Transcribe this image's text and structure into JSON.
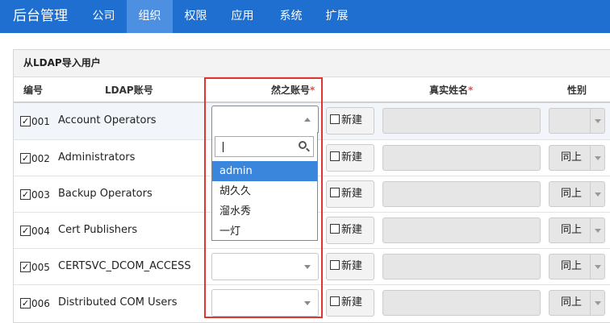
{
  "nav": {
    "brand": "后台管理",
    "items": [
      {
        "label": "公司",
        "active": false
      },
      {
        "label": "组织",
        "active": true
      },
      {
        "label": "权限",
        "active": false
      },
      {
        "label": "应用",
        "active": false
      },
      {
        "label": "系统",
        "active": false
      },
      {
        "label": "扩展",
        "active": false
      }
    ]
  },
  "panel": {
    "title": "从LDAP导入用户",
    "columns": {
      "number": "编号",
      "ldap_account": "LDAP账号",
      "ranzhi_account": "然之账号",
      "real_name": "真实姓名",
      "gender": "性别",
      "required_mark": "*"
    },
    "new_label": "新建",
    "rows": [
      {
        "number": "001",
        "checked": true,
        "ldap": "Account Operators",
        "account": "",
        "gender": ""
      },
      {
        "number": "002",
        "checked": true,
        "ldap": "Administrators",
        "account": "",
        "gender": "同上"
      },
      {
        "number": "003",
        "checked": true,
        "ldap": "Backup Operators",
        "account": "",
        "gender": "同上"
      },
      {
        "number": "004",
        "checked": true,
        "ldap": "Cert Publishers",
        "account": "",
        "gender": "同上"
      },
      {
        "number": "005",
        "checked": true,
        "ldap": "CERTSVC_DCOM_ACCESS",
        "account": "",
        "gender": "同上"
      },
      {
        "number": "006",
        "checked": true,
        "ldap": "Distributed COM Users",
        "account": "",
        "gender": "同上"
      }
    ]
  },
  "dropdown": {
    "search_value": "",
    "options": [
      "admin",
      "胡久久",
      "溜水秀",
      "一灯"
    ],
    "highlighted": "admin"
  },
  "colors": {
    "nav": "#1e6fd0",
    "nav_active": "#4d8fe0",
    "highlight_border": "#e03535",
    "option_selected": "#3a86dd"
  }
}
